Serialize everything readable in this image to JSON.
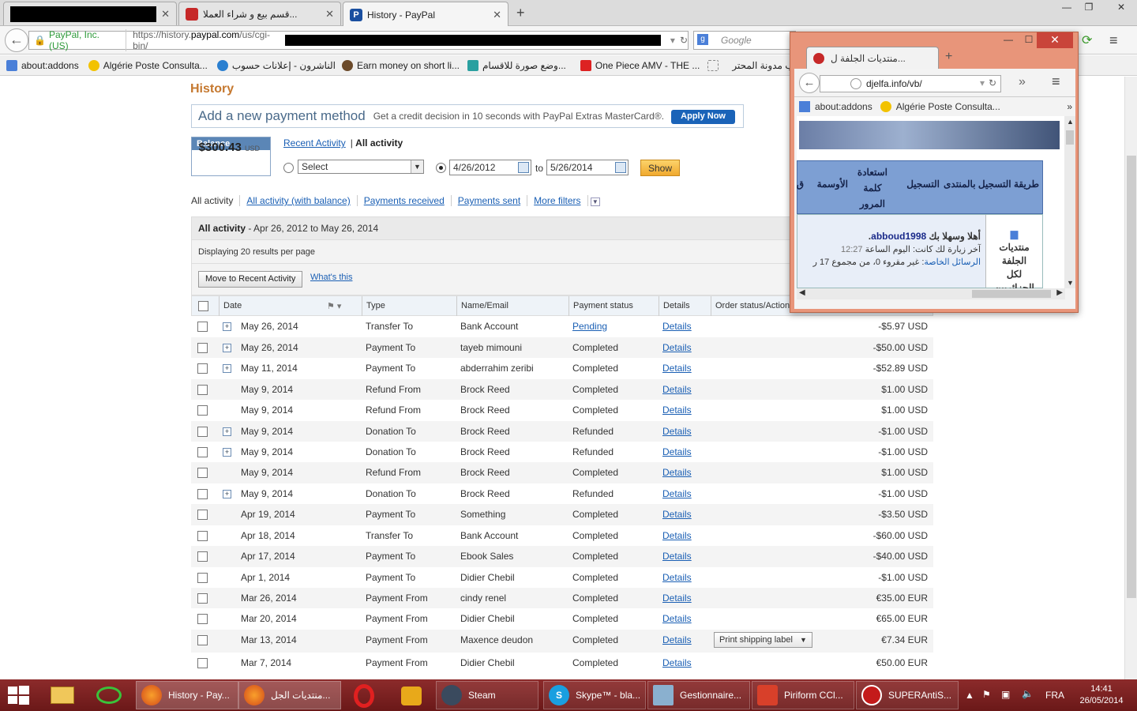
{
  "browser": {
    "tabs": [
      {
        "title": "",
        "redacted": true
      },
      {
        "title": "قسم بيع و شراء العملا..."
      },
      {
        "title": "History - PayPal"
      }
    ],
    "identity": "PayPal, Inc. (US)",
    "url_prefix": "https://history.",
    "url_domain": "paypal.com",
    "url_suffix": "/us/cgi-bin/",
    "search_placeholder": "Google",
    "bookmarks": [
      "about:addons",
      "Algérie Poste Consulta...",
      "الناشرون - إعلانات حسوب",
      "Earn money on short li...",
      "وضع صورة للاقسام...",
      "One Piece AMV - THE ...",
      "",
      "الب مدونة المحتر"
    ]
  },
  "paypal": {
    "page_title": "History",
    "promo": {
      "headline": "Add a new payment method",
      "text": "Get a credit decision in 10 seconds with PayPal Extras MasterCard®.",
      "button": "Apply Now"
    },
    "balance": {
      "label": "Balance",
      "amount": "$300.43",
      "currency": "USD"
    },
    "view": {
      "recent": "Recent Activity",
      "all": "All activity"
    },
    "select_value": "Select",
    "date_from": "4/26/2012",
    "date_to_label": "to",
    "date_to": "5/26/2014",
    "show_button": "Show",
    "filters": [
      "All activity",
      "All activity (with balance)",
      "Payments received",
      "Payments sent",
      "More filters"
    ],
    "summary_bold": "All activity",
    "summary_range": " - Apr 26, 2012 to May 26, 2014",
    "per_page": "Displaying 20 results per page",
    "move_button": "Move to Recent Activity",
    "whats_this": "What's this",
    "columns": [
      "Date",
      "Type",
      "Name/Email",
      "Payment status",
      "Details",
      "Order status/Actions"
    ],
    "rows": [
      {
        "date": "May 26, 2014",
        "type": "Transfer To",
        "name": "Bank Account",
        "status": "Pending",
        "status_link": true,
        "details": "Details",
        "amount": "-$5.97 USD",
        "expand": true
      },
      {
        "date": "May 26, 2014",
        "type": "Payment To",
        "name": "tayeb mimouni",
        "status": "Completed",
        "details": "Details",
        "amount": "-$50.00 USD",
        "expand": true
      },
      {
        "date": "May 11, 2014",
        "type": "Payment To",
        "name": "abderrahim zeribi",
        "status": "Completed",
        "details": "Details",
        "amount": "-$52.89 USD",
        "expand": true
      },
      {
        "date": "May 9, 2014",
        "type": "Refund From",
        "name": "Brock Reed",
        "status": "Completed",
        "details": "Details",
        "amount": "$1.00 USD",
        "expand": false
      },
      {
        "date": "May 9, 2014",
        "type": "Refund From",
        "name": "Brock Reed",
        "status": "Completed",
        "details": "Details",
        "amount": "$1.00 USD",
        "expand": false
      },
      {
        "date": "May 9, 2014",
        "type": "Donation To",
        "name": "Brock Reed",
        "status": "Refunded",
        "details": "Details",
        "amount": "-$1.00 USD",
        "expand": true
      },
      {
        "date": "May 9, 2014",
        "type": "Donation To",
        "name": "Brock Reed",
        "status": "Refunded",
        "details": "Details",
        "amount": "-$1.00 USD",
        "expand": true
      },
      {
        "date": "May 9, 2014",
        "type": "Refund From",
        "name": "Brock Reed",
        "status": "Completed",
        "details": "Details",
        "amount": "$1.00 USD",
        "expand": false
      },
      {
        "date": "May 9, 2014",
        "type": "Donation To",
        "name": "Brock Reed",
        "status": "Refunded",
        "details": "Details",
        "amount": "-$1.00 USD",
        "expand": true
      },
      {
        "date": "Apr 19, 2014",
        "type": "Payment To",
        "name": "Something",
        "status": "Completed",
        "details": "Details",
        "amount": "-$3.50 USD",
        "expand": false
      },
      {
        "date": "Apr 18, 2014",
        "type": "Transfer To",
        "name": "Bank Account",
        "status": "Completed",
        "details": "Details",
        "amount": "-$60.00 USD",
        "expand": false
      },
      {
        "date": "Apr 17, 2014",
        "type": "Payment To",
        "name": "Ebook Sales",
        "status": "Completed",
        "details": "Details",
        "amount": "-$40.00 USD",
        "expand": false
      },
      {
        "date": "Apr 1, 2014",
        "type": "Payment To",
        "name": "Didier Chebil",
        "status": "Completed",
        "details": "Details",
        "amount": "-$1.00 USD",
        "expand": false
      },
      {
        "date": "Mar 26, 2014",
        "type": "Payment From",
        "name": "cindy renel",
        "status": "Completed",
        "details": "Details",
        "amount": "€35.00 EUR",
        "expand": false
      },
      {
        "date": "Mar 20, 2014",
        "type": "Payment From",
        "name": "Didier Chebil",
        "status": "Completed",
        "details": "Details",
        "amount": "€65.00 EUR",
        "expand": false
      },
      {
        "date": "Mar 13, 2014",
        "type": "Payment From",
        "name": "Maxence deudon",
        "status": "Completed",
        "details": "Details",
        "amount": "€7.34 EUR",
        "expand": false,
        "action": "Print shipping label"
      },
      {
        "date": "Mar 7, 2014",
        "type": "Payment From",
        "name": "Didier Chebil",
        "status": "Completed",
        "details": "Details",
        "amount": "€50.00 EUR",
        "expand": false
      }
    ]
  },
  "popup": {
    "tab_title": "منتديات الجلفة ل...",
    "url": "djelfa.info/vb/",
    "bookmarks": [
      "about:addons",
      "Algérie Poste Consulta..."
    ],
    "nav": [
      "طريقة التسجيل بالمنتدى",
      "التسجيل",
      "استعادة",
      "كلمة",
      "المرور",
      "الأوسمة",
      "ق"
    ],
    "forum_label_lines": [
      "منتديات",
      "الجلفة",
      "لكل",
      "الجزائريين"
    ],
    "welcome": "أهلا وسهلا بك",
    "username": "abboud1998",
    "last_visit": "آخر زيارة لك كانت: اليوم الساعة",
    "last_time": "12:27",
    "pm_label": "الرسائل الخاصة",
    "pm_text": ": غير مقروء 0، من مجموع 17 ر"
  },
  "taskbar": {
    "items": [
      "History - Pay...",
      "منتديات الجل...",
      "Steam",
      "Skype™ - bla...",
      "Gestionnaire...",
      "Piriform CCl...",
      "SUPERAntiS..."
    ],
    "lang": "FRA",
    "time": "14:41",
    "date": "26/05/2014"
  },
  "colors": {
    "accent": "#1a5fb4",
    "title": "#c5782f",
    "taskbar": "#7a2020"
  }
}
